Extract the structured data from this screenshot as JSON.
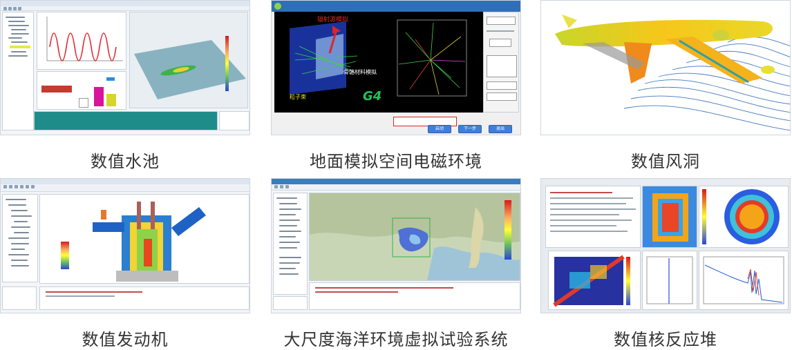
{
  "captions": {
    "c1": "数值水池",
    "c2": "地面模拟空间电磁环境",
    "c3": "数值风洞",
    "c4": "数值发动机",
    "c5": "大尺度海洋环境虚拟试验系统",
    "c6": "数值核反应堆"
  },
  "dialog": {
    "title_text": "G4",
    "label_top": "辐射源模拟",
    "label_mid": "骨骼材料模拟",
    "label_bottom": "粒子束",
    "buttons": [
      "启动",
      "下一步",
      "退出"
    ]
  },
  "colors": {
    "caption_text": "#333333",
    "accent_blue": "#3f7fd9",
    "dialog_black": "#000000"
  }
}
